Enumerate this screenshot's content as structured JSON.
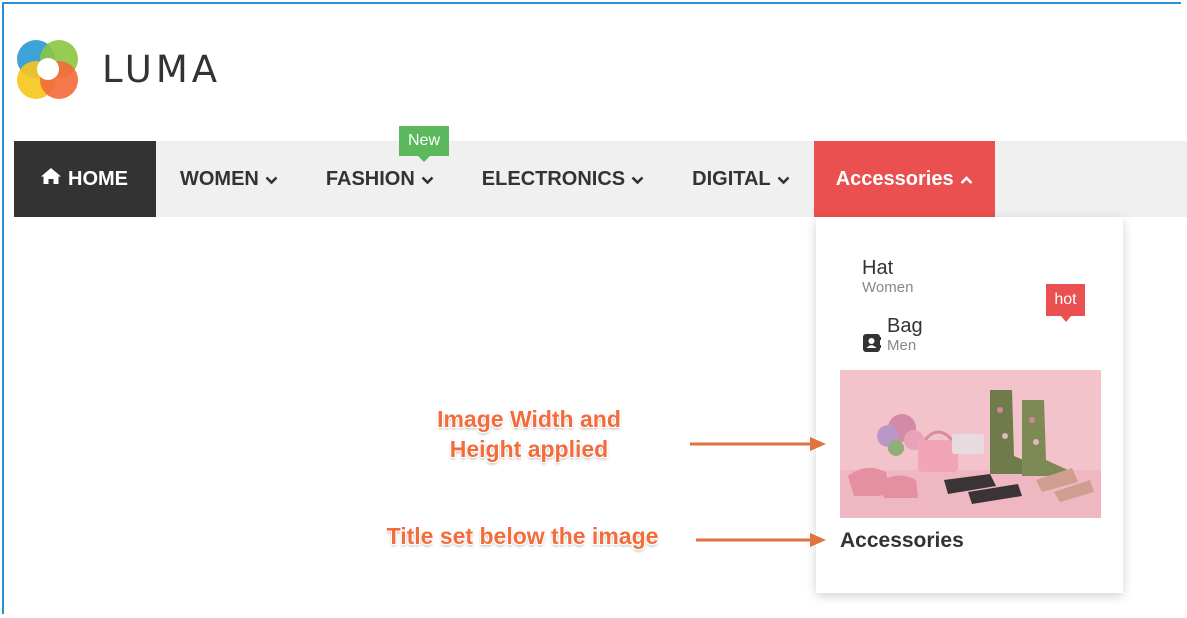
{
  "brand": {
    "name": "LUMA",
    "logo_icon": "luma-logo-icon"
  },
  "nav": {
    "items": [
      {
        "label": "HOME",
        "icon": "home-icon"
      },
      {
        "label": "WOMEN",
        "icon": "chevron-down-icon"
      },
      {
        "label": "FASHION",
        "icon": "chevron-down-icon",
        "badge": "New"
      },
      {
        "label": "ELECTRONICS",
        "icon": "chevron-down-icon"
      },
      {
        "label": "DIGITAL",
        "icon": "chevron-down-icon"
      },
      {
        "label": "Accessories",
        "icon": "chevron-up-icon"
      }
    ]
  },
  "dropdown": {
    "items": [
      {
        "title": "Hat",
        "subtitle": "Women"
      },
      {
        "title": "Bag",
        "subtitle": "Men",
        "icon": "contact-book-icon",
        "badge": "hot"
      }
    ],
    "image_caption": "Accessories"
  },
  "annotations": {
    "image_note": "Image Width and Height applied",
    "title_note": "Title set below the image"
  },
  "colors": {
    "home_bg": "#333333",
    "accent_red": "#e9504f",
    "badge_green": "#5cb85c",
    "navbar_bg": "#f0f0f0",
    "annotation_orange": "#f26c3c"
  }
}
